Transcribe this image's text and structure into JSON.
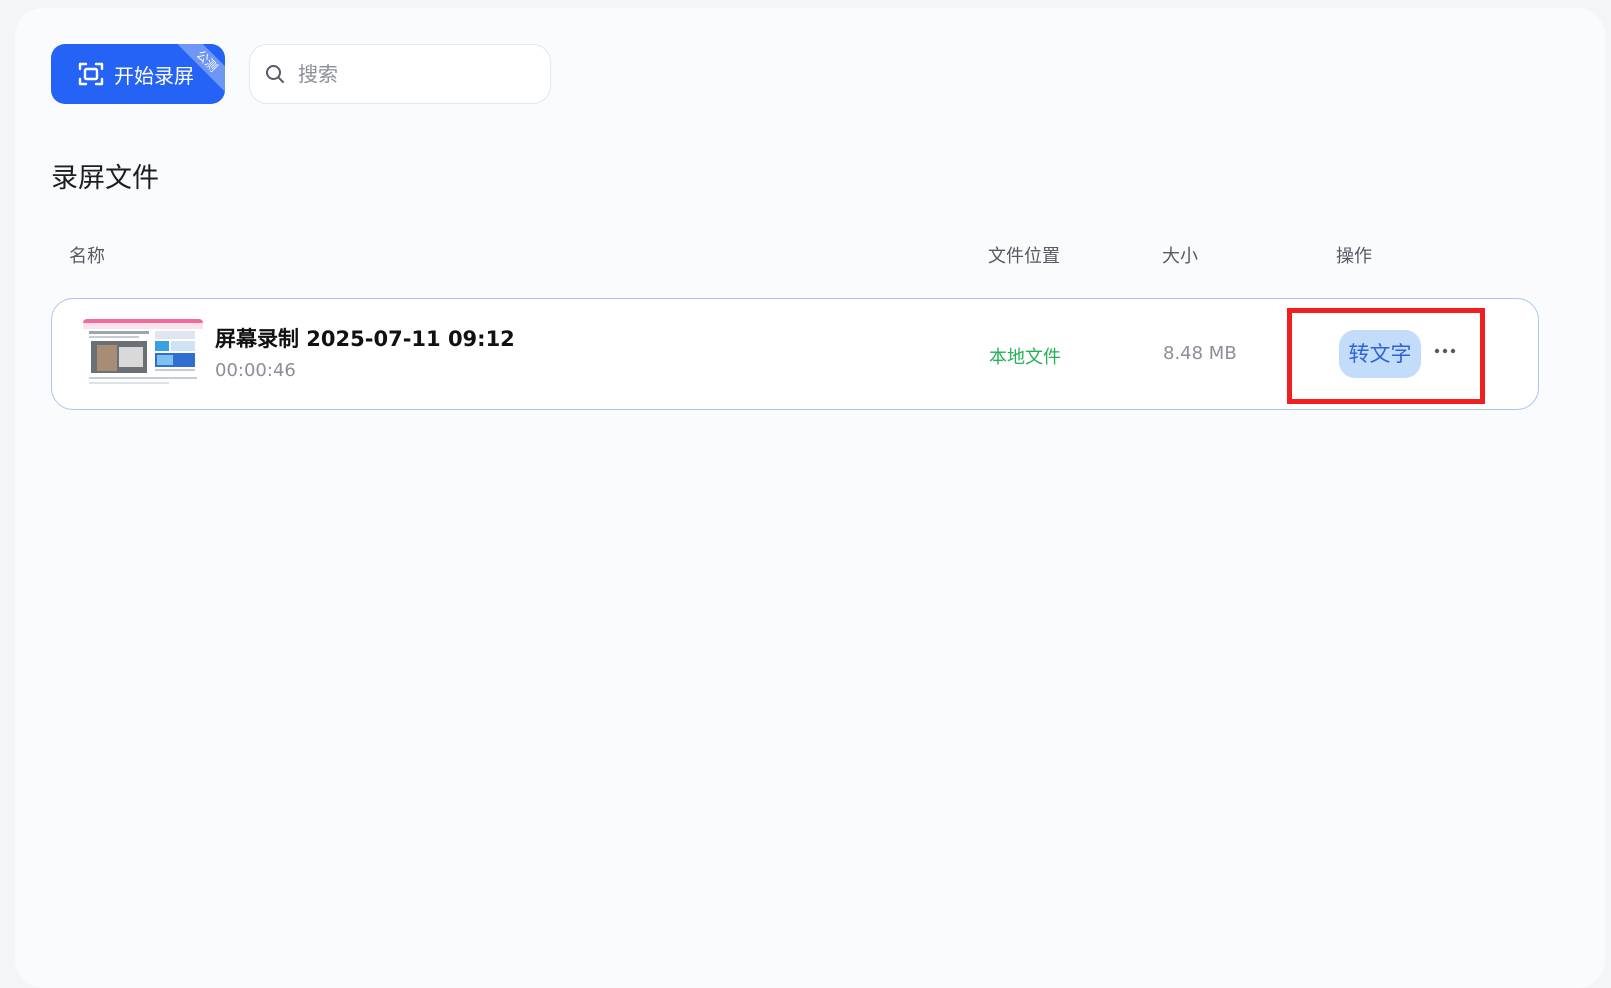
{
  "toolbar": {
    "start_record_label": "开始录屏",
    "beta_ribbon": "公测",
    "search_placeholder": "搜索"
  },
  "section": {
    "title": "录屏文件"
  },
  "table": {
    "columns": {
      "name": "名称",
      "location": "文件位置",
      "size": "大小",
      "actions": "操作"
    },
    "rows": [
      {
        "name": "屏幕录制 2025-07-11 09:12",
        "duration": "00:00:46",
        "location": "本地文件",
        "size": "8.48 MB",
        "transcribe_label": "转文字",
        "more_icon": "more-horizontal-icon"
      }
    ]
  },
  "colors": {
    "primary": "#2563f6",
    "location_green": "#23b255",
    "highlight_red": "#f02020",
    "transcribe_bg": "#c3dcf9"
  }
}
